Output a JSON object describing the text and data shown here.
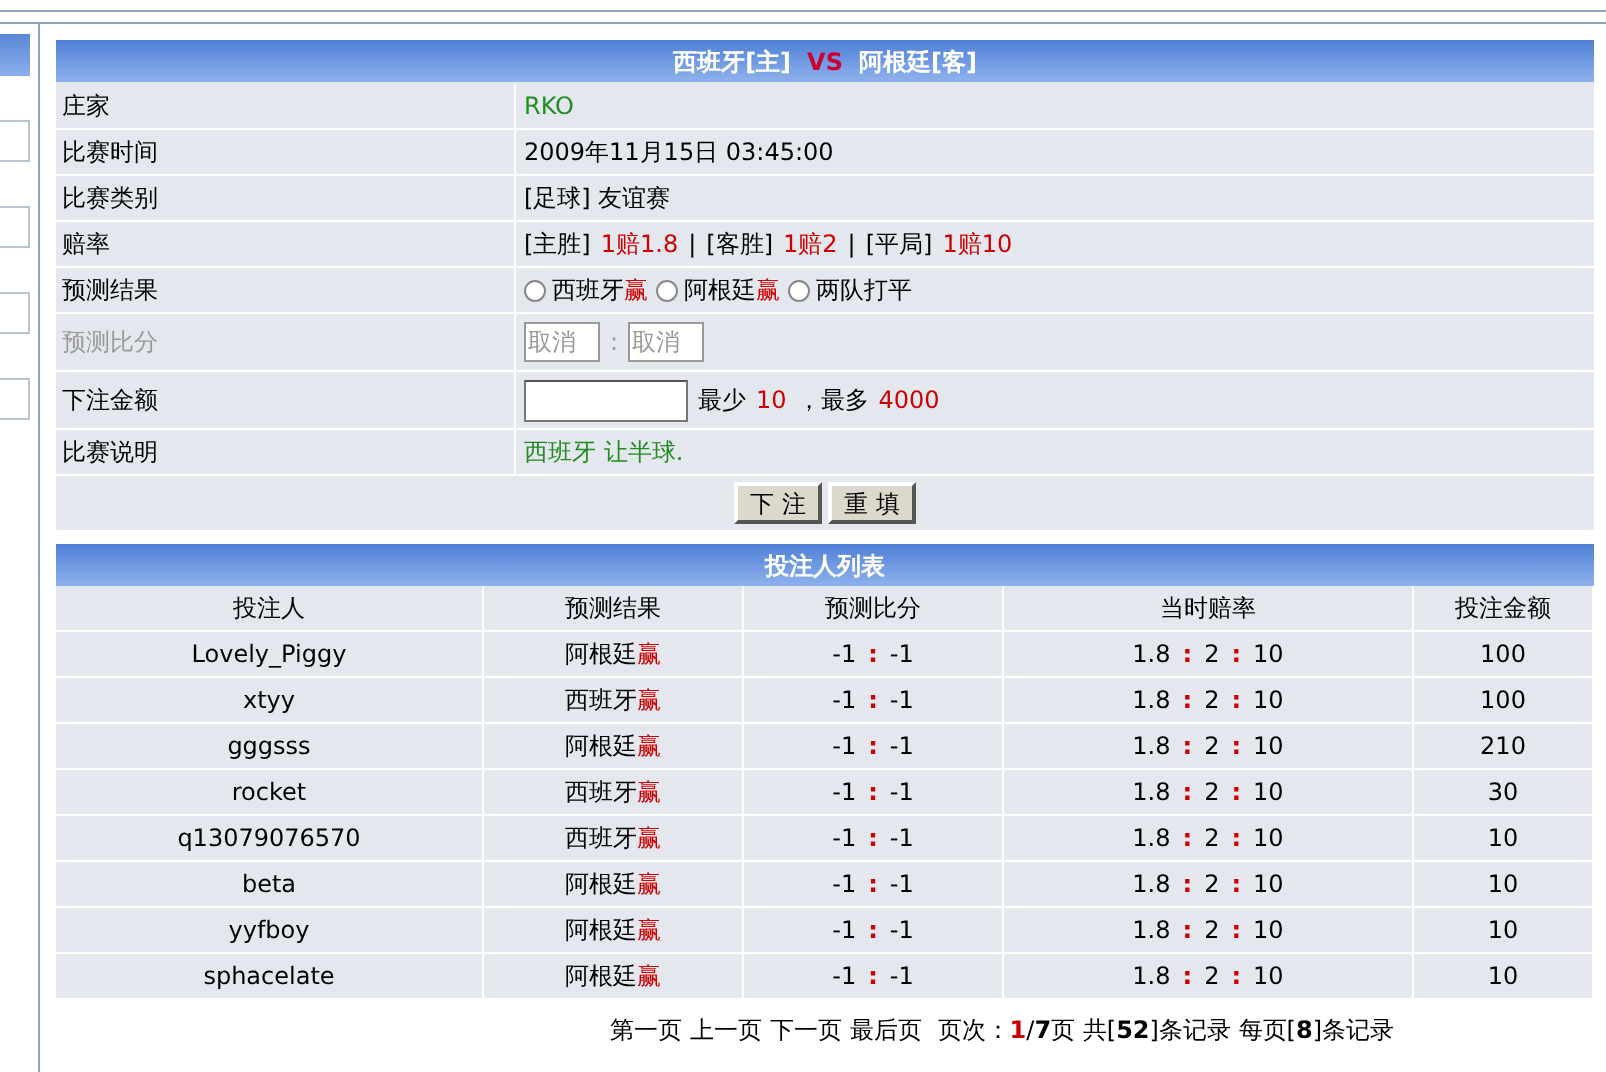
{
  "sidebar": {
    "items": [
      {
        "selected": true
      },
      {
        "selected": false
      },
      {
        "selected": false
      },
      {
        "selected": false
      },
      {
        "selected": false
      }
    ]
  },
  "match": {
    "home": "西班牙[主]",
    "vs": "VS",
    "away": "阿根廷[客]"
  },
  "details": [
    {
      "kind": "text",
      "label": "庄家",
      "segments": [
        {
          "text": "RKO",
          "color": "#228b22"
        }
      ]
    },
    {
      "kind": "text",
      "label": "比赛时间",
      "segments": [
        {
          "text": "2009年11月15日 03:45:00",
          "color": "#000000"
        }
      ]
    },
    {
      "kind": "text",
      "label": "比赛类别",
      "segments": [
        {
          "text": "[足球] 友谊赛",
          "color": "#000000"
        }
      ]
    },
    {
      "kind": "text",
      "label": "赔率",
      "segments": [
        {
          "text": "[主胜]",
          "color": "#000000"
        },
        {
          "text": "1赔1.8",
          "color": "#cc0000"
        },
        {
          "text": "|",
          "color": "#000000"
        },
        {
          "text": "[客胜]",
          "color": "#000000"
        },
        {
          "text": "1赔2",
          "color": "#cc0000"
        },
        {
          "text": "|",
          "color": "#000000"
        },
        {
          "text": "[平局]",
          "color": "#000000"
        },
        {
          "text": "1赔10",
          "color": "#cc0000"
        }
      ]
    },
    {
      "kind": "radio",
      "label": "预测结果",
      "options": [
        {
          "segments": [
            {
              "text": "西班牙",
              "color": "#000000"
            },
            {
              "text": "赢",
              "color": "#cc0000"
            }
          ],
          "selected": false
        },
        {
          "segments": [
            {
              "text": "阿根廷",
              "color": "#000000"
            },
            {
              "text": "赢",
              "color": "#cc0000"
            }
          ],
          "selected": false
        },
        {
          "segments": [
            {
              "text": "两队打平",
              "color": "#000000"
            }
          ],
          "selected": false
        }
      ]
    },
    {
      "kind": "score",
      "label": "预测比分",
      "disabled": true,
      "home": "取消",
      "sep": ":",
      "away": "取消"
    },
    {
      "kind": "amount",
      "label": "下注金额",
      "segments": [
        {
          "text": "最少",
          "color": "#000000"
        },
        {
          "text": "10",
          "color": "#cc0000"
        },
        {
          "text": "，最多",
          "color": "#000000"
        },
        {
          "text": "4000",
          "color": "#cc0000"
        }
      ]
    },
    {
      "kind": "text",
      "label": "比赛说明",
      "segments": [
        {
          "text": "西班牙 让半球.",
          "color": "#228b22"
        }
      ]
    }
  ],
  "buttons": [
    "下 注",
    "重 填"
  ],
  "bettors": {
    "title": "投注人列表",
    "columns": [
      "投注人",
      "预测结果",
      "预测比分",
      "当时赔率",
      "投注金额"
    ],
    "rows": [
      {
        "name": "Lovely_Piggy",
        "team": "阿根廷",
        "mark": "赢",
        "score": [
          "-1",
          ":",
          "-1"
        ],
        "odds": [
          "1.8",
          ":",
          "2",
          ":",
          "10"
        ],
        "amount": "100"
      },
      {
        "name": "xtyy",
        "team": "西班牙",
        "mark": "赢",
        "score": [
          "-1",
          ":",
          "-1"
        ],
        "odds": [
          "1.8",
          ":",
          "2",
          ":",
          "10"
        ],
        "amount": "100"
      },
      {
        "name": "gggsss",
        "team": "阿根廷",
        "mark": "赢",
        "score": [
          "-1",
          ":",
          "-1"
        ],
        "odds": [
          "1.8",
          ":",
          "2",
          ":",
          "10"
        ],
        "amount": "210"
      },
      {
        "name": "rocket",
        "team": "西班牙",
        "mark": "赢",
        "score": [
          "-1",
          ":",
          "-1"
        ],
        "odds": [
          "1.8",
          ":",
          "2",
          ":",
          "10"
        ],
        "amount": "30"
      },
      {
        "name": "q13079076570",
        "team": "西班牙",
        "mark": "赢",
        "score": [
          "-1",
          ":",
          "-1"
        ],
        "odds": [
          "1.8",
          ":",
          "2",
          ":",
          "10"
        ],
        "amount": "10"
      },
      {
        "name": "beta",
        "team": "阿根廷",
        "mark": "赢",
        "score": [
          "-1",
          ":",
          "-1"
        ],
        "odds": [
          "1.8",
          ":",
          "2",
          ":",
          "10"
        ],
        "amount": "10"
      },
      {
        "name": "yyfboy",
        "team": "阿根廷",
        "mark": "赢",
        "score": [
          "-1",
          ":",
          "-1"
        ],
        "odds": [
          "1.8",
          ":",
          "2",
          ":",
          "10"
        ],
        "amount": "10"
      },
      {
        "name": "sphacelate",
        "team": "阿根廷",
        "mark": "赢",
        "score": [
          "-1",
          ":",
          "-1"
        ],
        "odds": [
          "1.8",
          ":",
          "2",
          ":",
          "10"
        ],
        "amount": "10"
      }
    ]
  },
  "pager": {
    "links": [
      "第一页",
      "上一页",
      "下一页",
      "最后页"
    ],
    "info": "页次：**1**/**7**页 共[**52**]条记录 每页[**8**]条记录"
  }
}
